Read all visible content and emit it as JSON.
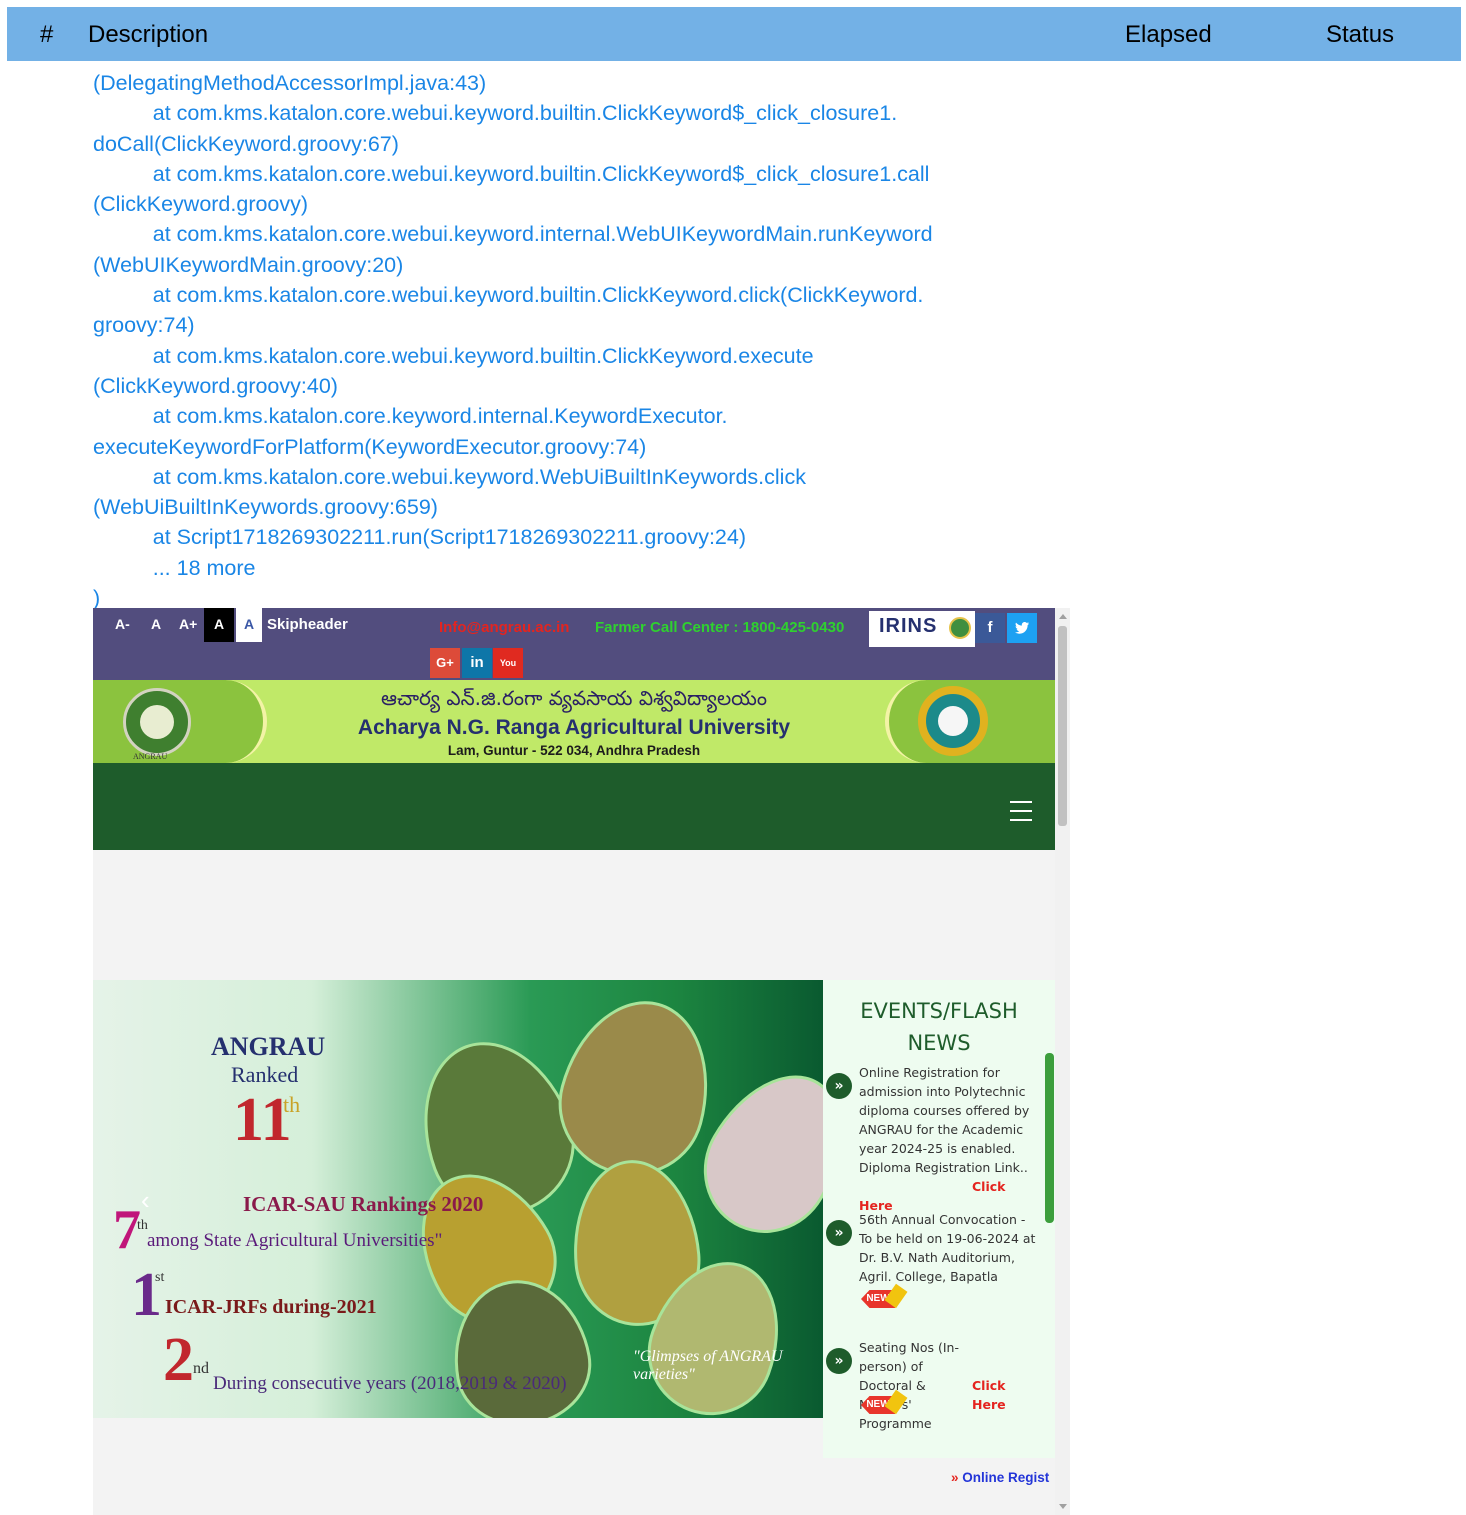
{
  "report_header": {
    "col_num": "#",
    "col_description": "Description",
    "col_elapsed": "Elapsed",
    "col_status": "Status"
  },
  "log_lines": [
    "(DelegatingMethodAccessorImpl.java:43)",
    "          at com.kms.katalon.core.webui.keyword.builtin.ClickKeyword$_click_closure1.",
    "doCall(ClickKeyword.groovy:67)",
    "          at com.kms.katalon.core.webui.keyword.builtin.ClickKeyword$_click_closure1.call",
    "(ClickKeyword.groovy)",
    "          at com.kms.katalon.core.webui.keyword.internal.WebUIKeywordMain.runKeyword",
    "(WebUIKeywordMain.groovy:20)",
    "          at com.kms.katalon.core.webui.keyword.builtin.ClickKeyword.click(ClickKeyword.",
    "groovy:74)",
    "          at com.kms.katalon.core.webui.keyword.builtin.ClickKeyword.execute",
    "(ClickKeyword.groovy:40)",
    "          at com.kms.katalon.core.keyword.internal.KeywordExecutor.",
    "executeKeywordForPlatform(KeywordExecutor.groovy:74)",
    "          at com.kms.katalon.core.webui.keyword.WebUiBuiltInKeywords.click",
    "(WebUiBuiltInKeywords.groovy:659)",
    "          at Script1718269302211.run(Script1718269302211.groovy:24)",
    "          ... 18 more",
    ")"
  ],
  "site": {
    "font_sizes": [
      "A-",
      "A",
      "A+",
      "A",
      "A"
    ],
    "skip_header": "Skipheader",
    "email": "Info@angrau.ac.in",
    "call_center": "Farmer Call Center : 1800-425-0430",
    "irins_logo": "IRINS",
    "social": {
      "facebook": "f",
      "twitter": "t",
      "google_plus": "G+",
      "linkedin": "in",
      "youtube": "You"
    },
    "title_telugu": "ఆచార్య ఎన్.జి.రంగా వ్యవసాయ విశ్వవిద్యాలయం",
    "title": "Acharya N.G. Ranga Agricultural University",
    "address": "Lam, Guntur - 522 034, Andhra Pradesh",
    "emblem_label": "ANGRAU",
    "slider": {
      "heading": "ANGRAU",
      "ranked": "Ranked",
      "rank_num": "11",
      "rank_sup": "th",
      "icar_sau": "ICAR-SAU Rankings 2020",
      "seventh": "7",
      "seventh_sup": "th",
      "among": "among State Agricultural Universities\"",
      "first": "1",
      "first_sup": "st",
      "jrf": "ICAR-JRFs during-2021",
      "second": "2",
      "second_sup": "nd",
      "consecutive": "During consecutive years (2018,2019 & 2020)",
      "glimpses": "\"Glimpses of ANGRAU varieties\""
    },
    "events": {
      "title_line1": "EVENTS/FLASH",
      "title_line2": "NEWS",
      "items": [
        {
          "text": "Online Registration for admission into Polytechnic diploma courses offered by ANGRAU for the Academic year 2024-25 is enabled. Diploma Registration Link..",
          "link": "Click Here"
        },
        {
          "text": "56th Annual Convocation - To be held on 19-06-2024 at Dr. B.V. Nath Auditorium, Agril. College, Bapatla",
          "link": ""
        },
        {
          "text": "Seating Nos (In-person) of Doctoral & Masters' Programme",
          "link": "Click Here"
        }
      ],
      "new_label": "NEW"
    },
    "marquee": "Online Regist"
  }
}
